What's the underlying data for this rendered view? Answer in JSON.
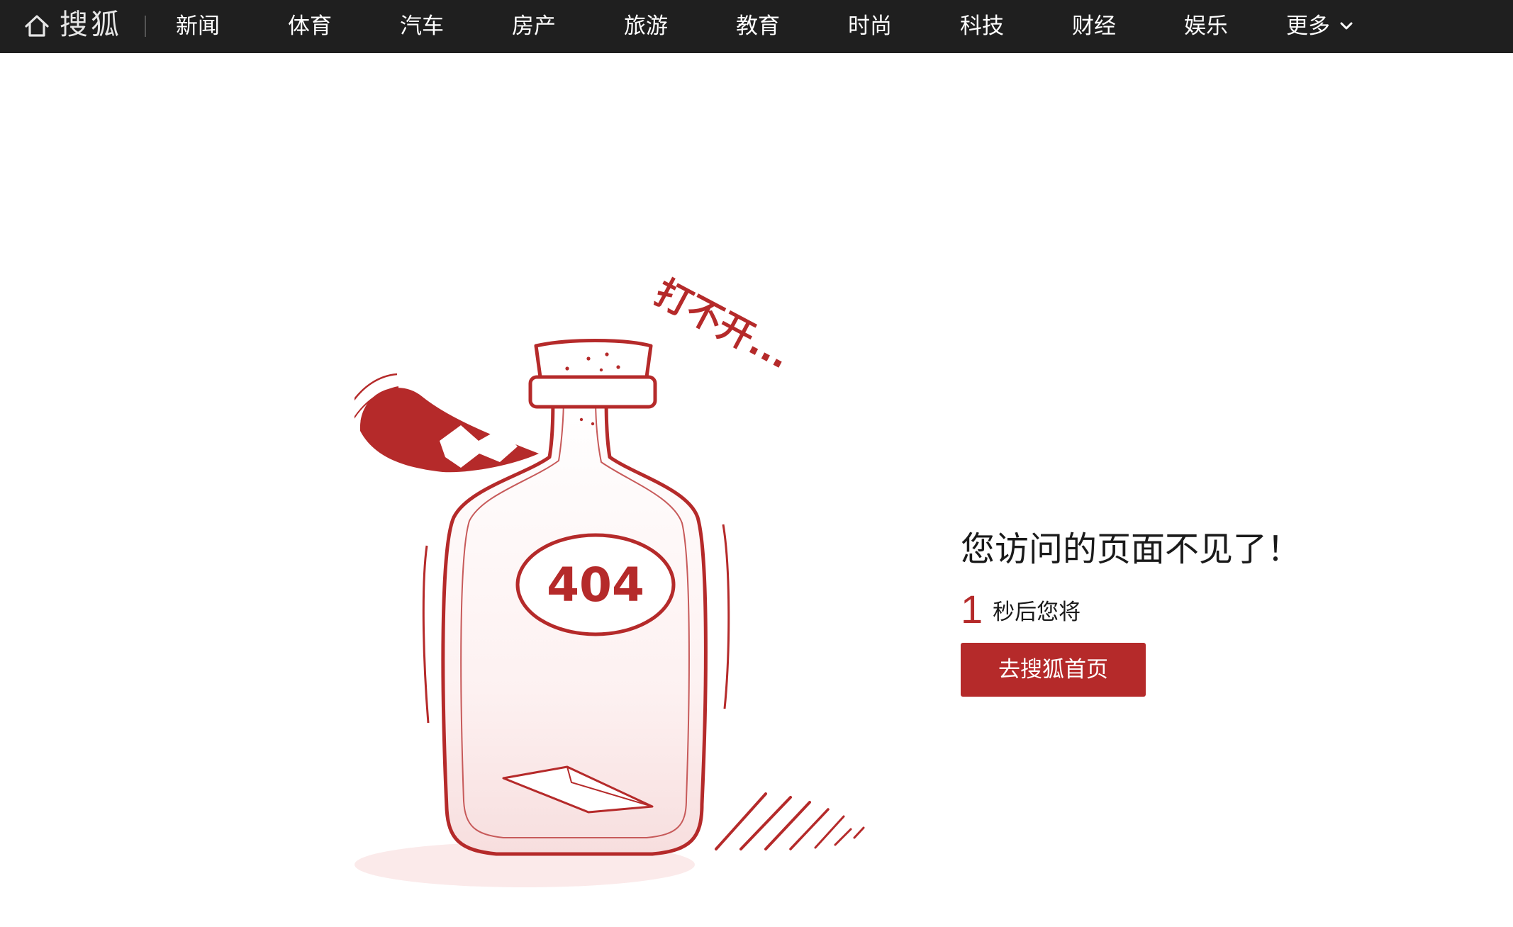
{
  "header": {
    "logo_text": "搜狐",
    "nav_items": [
      "新闻",
      "体育",
      "汽车",
      "房产",
      "旅游",
      "教育",
      "时尚",
      "科技",
      "财经",
      "娱乐",
      "更多"
    ]
  },
  "illustration": {
    "label": "404",
    "caption": "打不开..."
  },
  "message": {
    "title": "您访问的页面不见了！",
    "countdown_number": "1",
    "countdown_text": "秒后您将",
    "button_label": "去搜狐首页"
  },
  "colors": {
    "nav_background": "#1f1f1f",
    "accent": "#b52a2a"
  },
  "icons": {
    "home": "home-icon",
    "more": "chevron-down-icon"
  }
}
